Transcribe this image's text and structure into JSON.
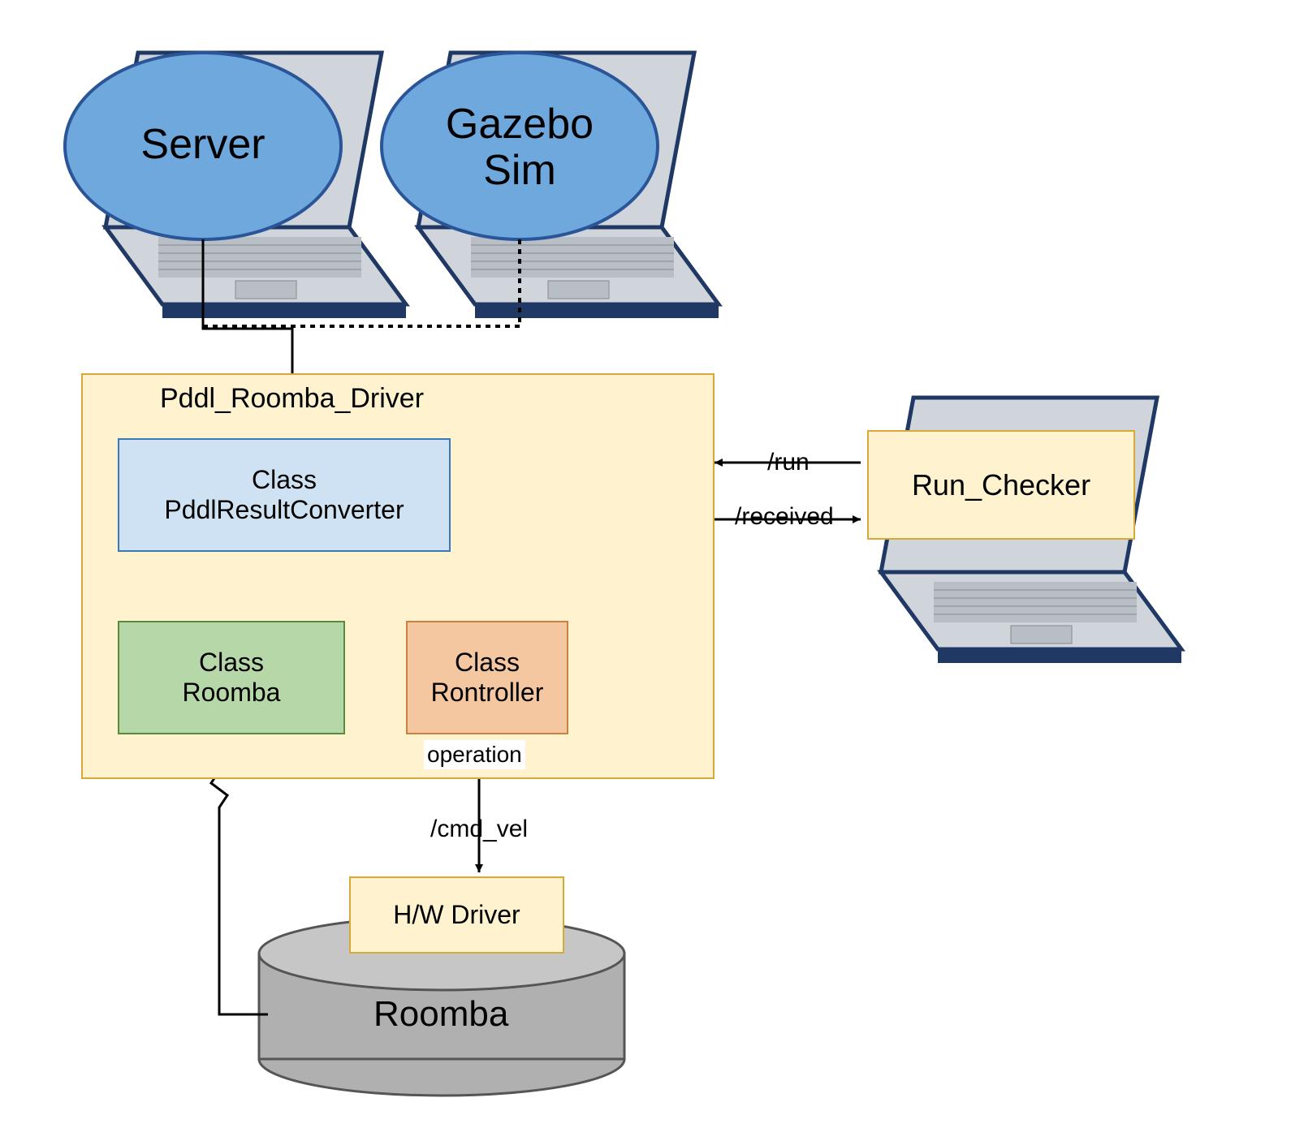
{
  "nodes": {
    "server": "Server",
    "gazebo": "Gazebo Sim",
    "pddl_driver_title": "Pddl_Roomba_Driver",
    "class_converter_l1": "Class",
    "class_converter_l2": "PddlResultConverter",
    "class_roomba_l1": "Class",
    "class_roomba_l2": "Roomba",
    "class_rontroller_l1": "Class",
    "class_rontroller_l2": "Rontroller",
    "run_checker": "Run_Checker",
    "hw_driver": "H/W Driver",
    "roomba_cyl": "Roomba"
  },
  "edges": {
    "operation": "operation",
    "cmd_vel": "/cmd_vel",
    "run": "/run",
    "received": "/received"
  },
  "colors": {
    "cream": "#fef2cf",
    "cream_border": "#d6a93a",
    "lightblue": "#cfe2f3",
    "green": "#b6d7a8",
    "orange": "#f4c7a0",
    "blue_ellipse": "#6fa8dc",
    "gray": "#b0b0b0",
    "navy": "#1f3864",
    "laptop_gray": "#d0d5db"
  }
}
